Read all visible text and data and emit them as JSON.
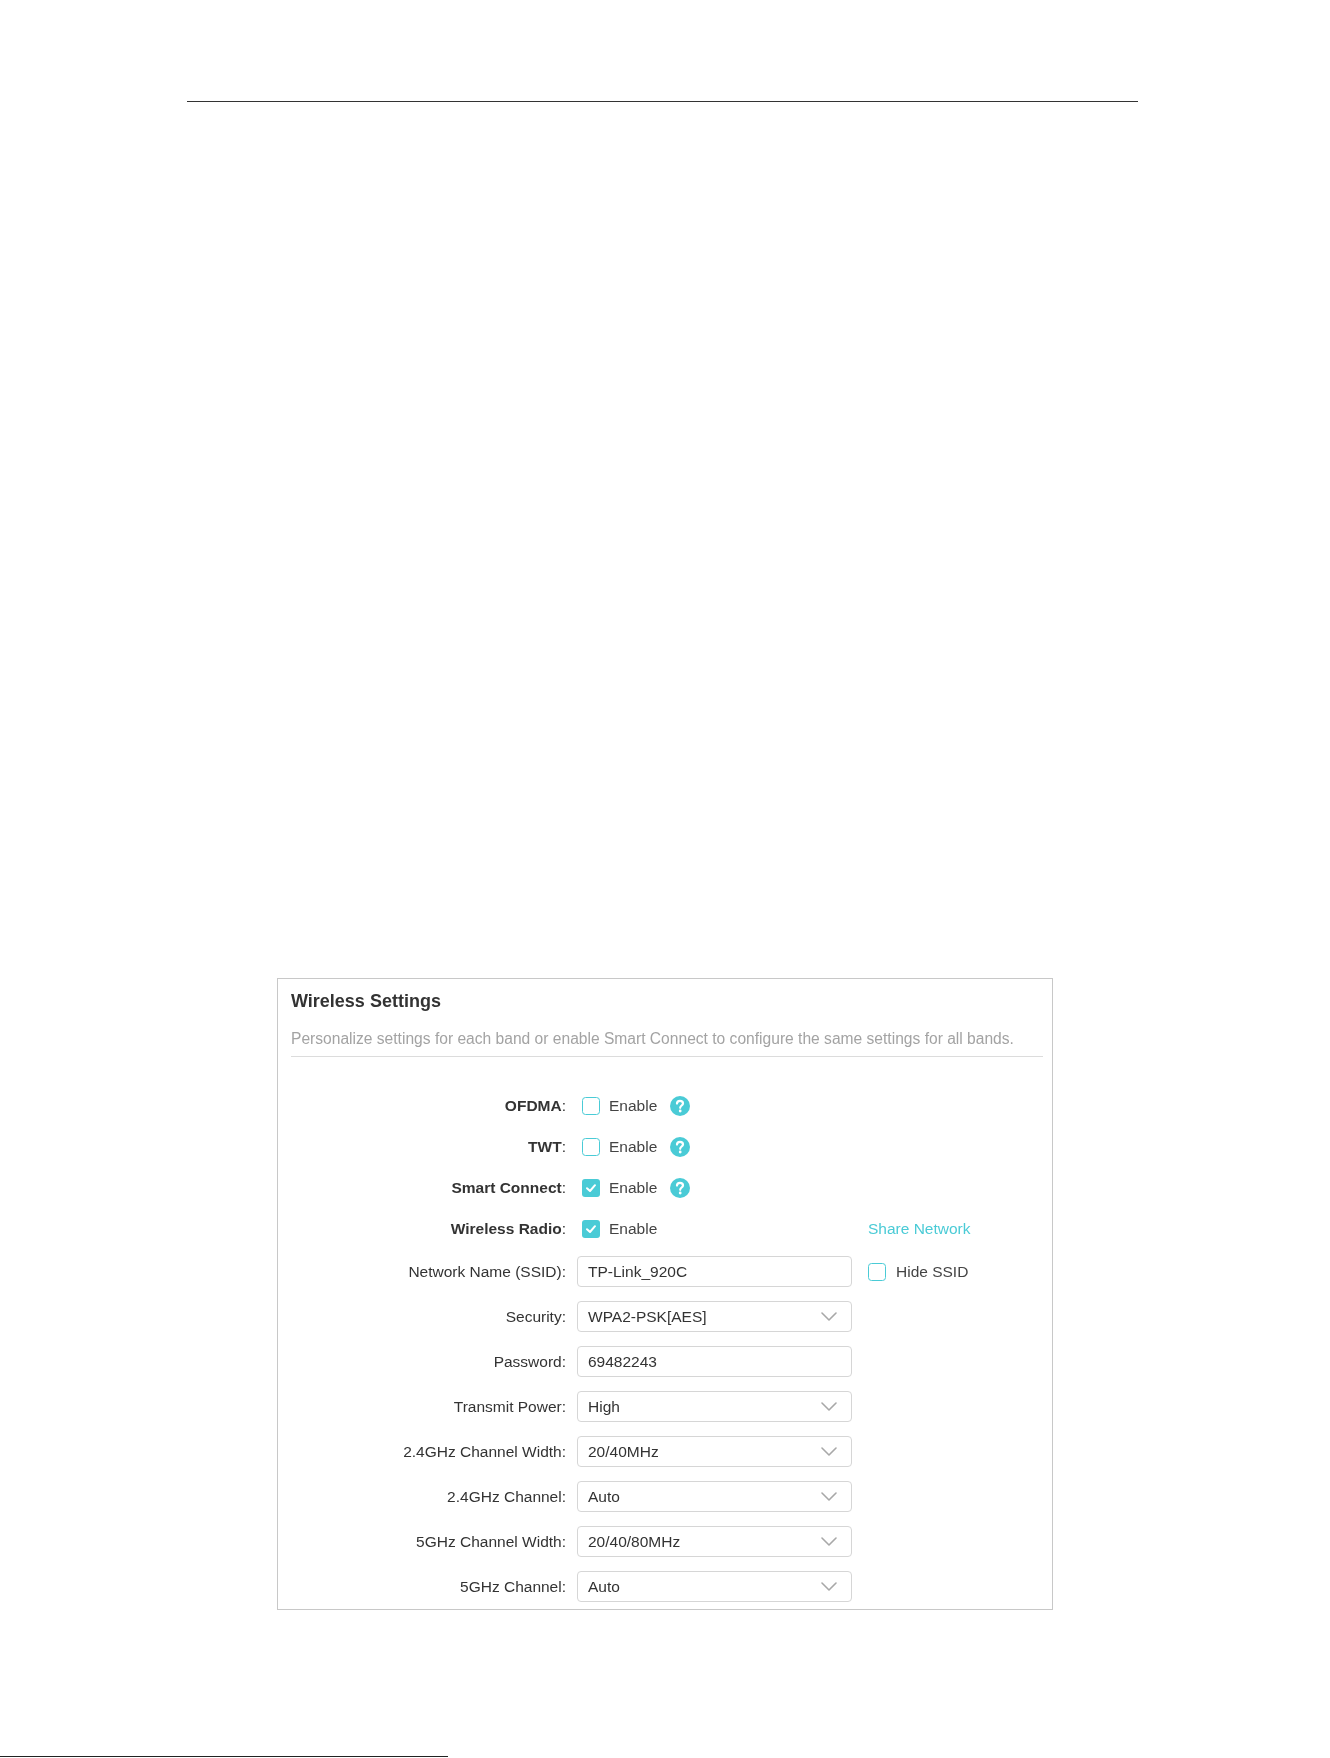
{
  "panel": {
    "title": "Wireless Settings",
    "description": "Personalize settings for each band or enable Smart Connect to configure the same settings for all bands."
  },
  "rows": [
    {
      "kind": "toggle",
      "label": "**OFDMA**:",
      "checked": false,
      "text": "Enable",
      "help": true
    },
    {
      "kind": "toggle",
      "label": "**TWT**:",
      "checked": false,
      "text": "Enable",
      "help": true
    },
    {
      "kind": "toggle",
      "label": "**Smart Connect**:",
      "checked": true,
      "text": "Enable",
      "help": true
    },
    {
      "kind": "toggle",
      "label": "**Wireless Radio**:",
      "checked": true,
      "text": "Enable",
      "help": false,
      "link": "Share Network"
    },
    {
      "kind": "text",
      "label": "Network Name (SSID):",
      "value": "TP-Link_920C",
      "extra": {
        "label": "Hide SSID",
        "checked": false
      }
    },
    {
      "kind": "select",
      "label": "Security:",
      "value": "WPA2-PSK[AES]"
    },
    {
      "kind": "text",
      "label": "Password:",
      "value": "69482243"
    },
    {
      "kind": "select",
      "label": "Transmit Power:",
      "value": "High"
    },
    {
      "kind": "select",
      "label": "2.4GHz Channel Width:",
      "value": "20/40MHz"
    },
    {
      "kind": "select",
      "label": "2.4GHz Channel:",
      "value": "Auto"
    },
    {
      "kind": "select",
      "label": "5GHz Channel Width:",
      "value": "20/40/80MHz"
    },
    {
      "kind": "select",
      "label": "5GHz Channel:",
      "value": "Auto"
    }
  ]
}
